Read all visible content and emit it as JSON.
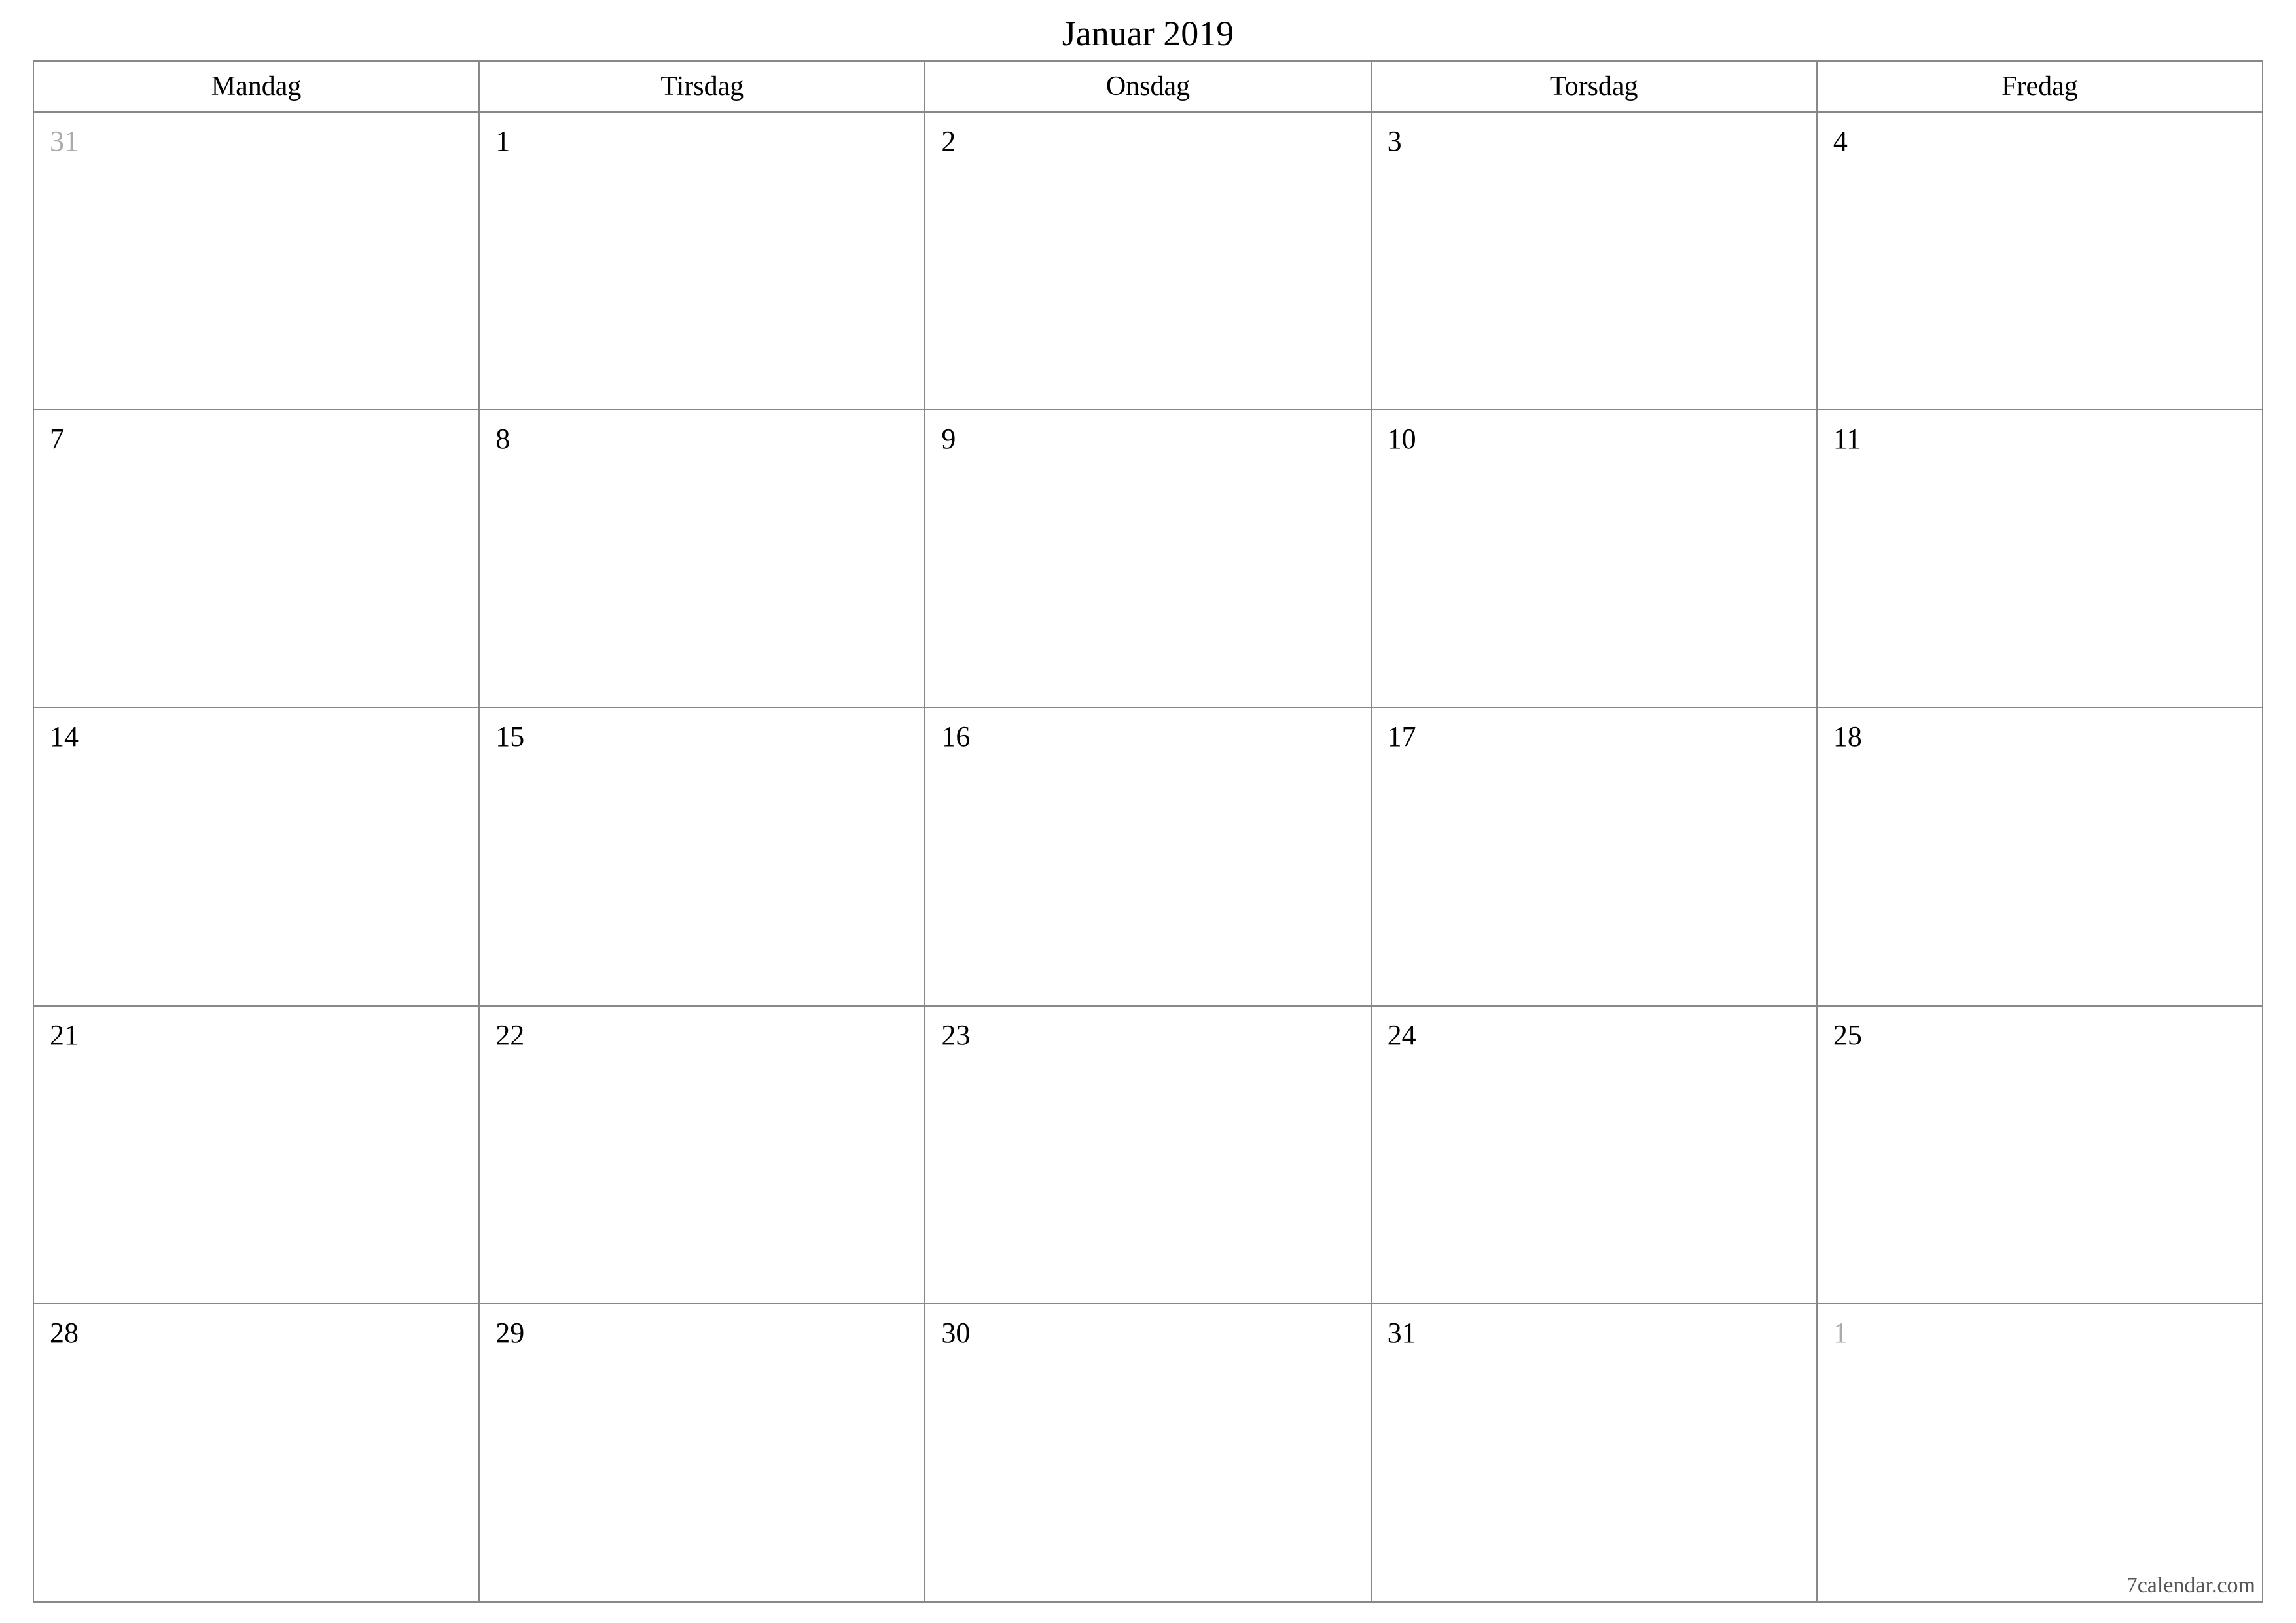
{
  "title": "Januar 2019",
  "weekdays": [
    "Mandag",
    "Tirsdag",
    "Onsdag",
    "Torsdag",
    "Fredag"
  ],
  "weeks": [
    [
      {
        "day": "31",
        "outside": true
      },
      {
        "day": "1",
        "outside": false
      },
      {
        "day": "2",
        "outside": false
      },
      {
        "day": "3",
        "outside": false
      },
      {
        "day": "4",
        "outside": false
      }
    ],
    [
      {
        "day": "7",
        "outside": false
      },
      {
        "day": "8",
        "outside": false
      },
      {
        "day": "9",
        "outside": false
      },
      {
        "day": "10",
        "outside": false
      },
      {
        "day": "11",
        "outside": false
      }
    ],
    [
      {
        "day": "14",
        "outside": false
      },
      {
        "day": "15",
        "outside": false
      },
      {
        "day": "16",
        "outside": false
      },
      {
        "day": "17",
        "outside": false
      },
      {
        "day": "18",
        "outside": false
      }
    ],
    [
      {
        "day": "21",
        "outside": false
      },
      {
        "day": "22",
        "outside": false
      },
      {
        "day": "23",
        "outside": false
      },
      {
        "day": "24",
        "outside": false
      },
      {
        "day": "25",
        "outside": false
      }
    ],
    [
      {
        "day": "28",
        "outside": false
      },
      {
        "day": "29",
        "outside": false
      },
      {
        "day": "30",
        "outside": false
      },
      {
        "day": "31",
        "outside": false
      },
      {
        "day": "1",
        "outside": true
      }
    ]
  ],
  "footer": "7calendar.com"
}
